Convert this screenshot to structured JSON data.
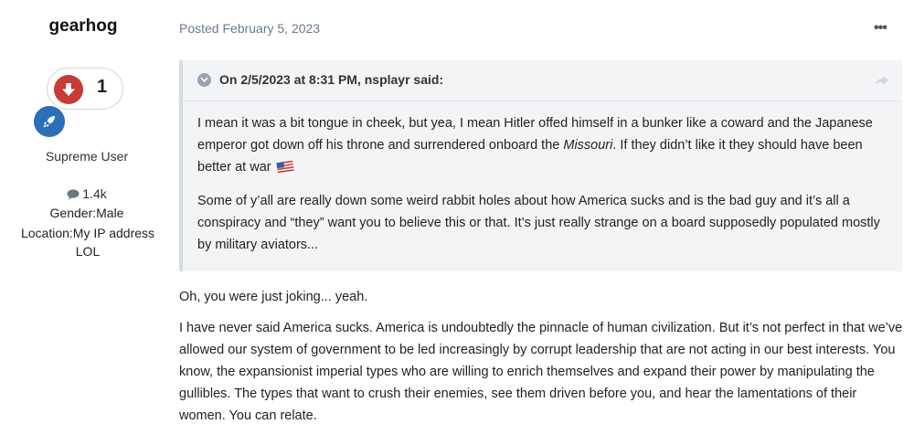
{
  "author": {
    "username": "gearhog",
    "reputation": "1",
    "title": "Supreme User",
    "posts_count": "1.4k",
    "gender": "Gender:Male",
    "location": "Location:My IP address LOL"
  },
  "post": {
    "posted": "Posted February 5, 2023",
    "more_label": "•••"
  },
  "quote": {
    "header": "On 2/5/2023 at 8:31 PM, nsplayr said:",
    "p1_before": "I mean it was a bit tongue in cheek, but yea, I mean Hitler offed himself in a bunker like a coward and the Japanese emperor got down off his throne and surrendered onboard the ",
    "p1_italic": "Missouri",
    "p1_after": ". If they didn’t like it they should have been better at war",
    "p2": "Some of y’all are really down some weird rabbit holes about how America sucks and is the bad guy and it’s all a conspiracy and “they” want you to believe this or that. It’s just really strange on a board supposedly populated mostly by military aviators..."
  },
  "reply": {
    "p1": "Oh, you were just joking... yeah.",
    "p2": "I have never said America sucks. America is undoubtedly the pinnacle of human civilization. But it’s not perfect in that we’ve allowed our system of government to be led increasingly by corrupt leadership that are not acting in our best interests. You know, the expansionist imperial types who are willing to enrich themselves and expand their power by manipulating the gullibles. The types that want to crush their enemies, see them driven before you, and hear the lamentations of their women. You can relate."
  },
  "colors": {
    "downvote": "#c83a34",
    "rank_badge": "#2c6fb7",
    "meta_text": "#6c7a8c",
    "quote_bg": "#f3f4f6"
  },
  "icons": [
    "downvote-icon",
    "rocket-icon",
    "chat-icon",
    "quote-collapse-icon",
    "share-icon",
    "us-flag-icon",
    "more-options-icon"
  ]
}
